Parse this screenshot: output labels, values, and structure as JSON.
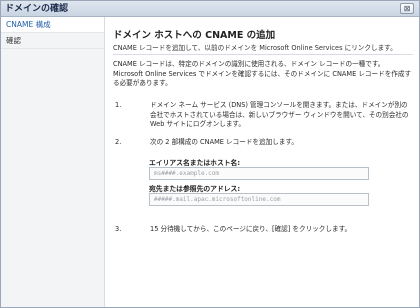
{
  "window": {
    "title": "ドメインの確認",
    "close_label": "⊠"
  },
  "sidebar": {
    "items": [
      {
        "label": "CNAME 構成",
        "active": true
      },
      {
        "label": "確認",
        "active": false
      }
    ]
  },
  "main": {
    "heading": "ドメイン ホストへの CNAME の追加",
    "subtitle": "CNAME レコードを追加して、以前のドメインを Microsoft Online Services にリンクします。",
    "intro": "CNAME レコードは、特定のドメインの識別に使用される、ドメイン レコードの一種です。Microsoft Online Services でドメインを確認するには、そのドメインに CNAME レコードを作成する必要があります。",
    "steps": [
      {
        "number": "1.",
        "text": "ドメイン ネーム サービス (DNS) 管理コンソールを開きます。または、ドメインが別の会社でホストされている場合は、新しいブラウザー ウィンドウを開いて、その別会社の Web サイトにログオンします。"
      },
      {
        "number": "2.",
        "text": "次の 2 部構成の CNAME レコードを追加します。"
      },
      {
        "number": "3.",
        "text": "15 分待機してから、このページに戻り、[確認] をクリックします。"
      }
    ],
    "fields": {
      "alias": {
        "label": "エイリアス名またはホスト名:",
        "value": "ms####.example.com"
      },
      "target": {
        "label": "宛先または参照先のアドレス:",
        "value": "#####.mail.apac.microsoftonline.com"
      }
    }
  }
}
